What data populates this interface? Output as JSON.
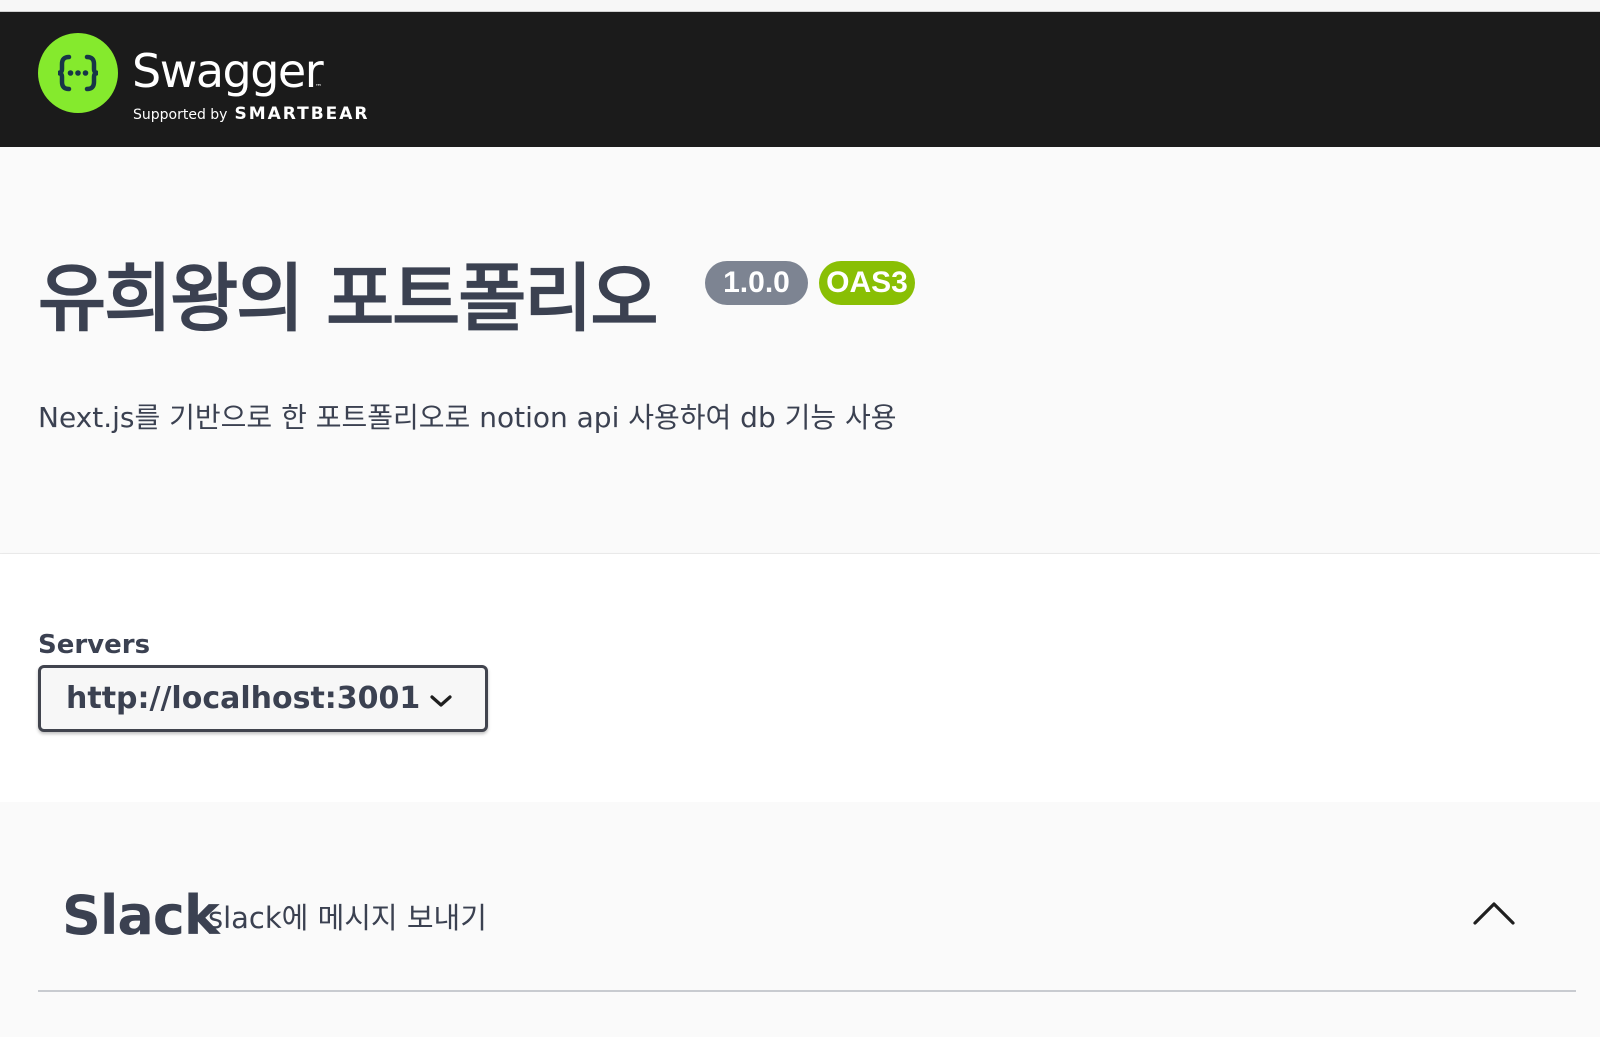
{
  "topbar": {
    "logo": {
      "wordmark": "Swagger",
      "trademark": "™",
      "supported_by": "Supported by",
      "brand": "SMARTBEAR",
      "icon": "swagger-braces-icon"
    },
    "colors": {
      "background": "#1b1b1b",
      "logo_green": "#85ea2d"
    }
  },
  "info": {
    "title": "유희왕의 포트폴리오",
    "version": "1.0.0",
    "spec_badge": "OAS3",
    "description": "Next.js를 기반으로 한 포트폴리오로 notion api 사용하여 db 기능 사용",
    "colors": {
      "version_badge": "#7d8492",
      "spec_badge": "#89bf04"
    }
  },
  "servers": {
    "label": "Servers",
    "selected": "http://localhost:3001",
    "icon": "chevron-down-icon"
  },
  "tags": [
    {
      "name": "Slack",
      "description": "slack에 메시지 보내기",
      "expanded": true,
      "icon": "chevron-up-icon"
    }
  ]
}
